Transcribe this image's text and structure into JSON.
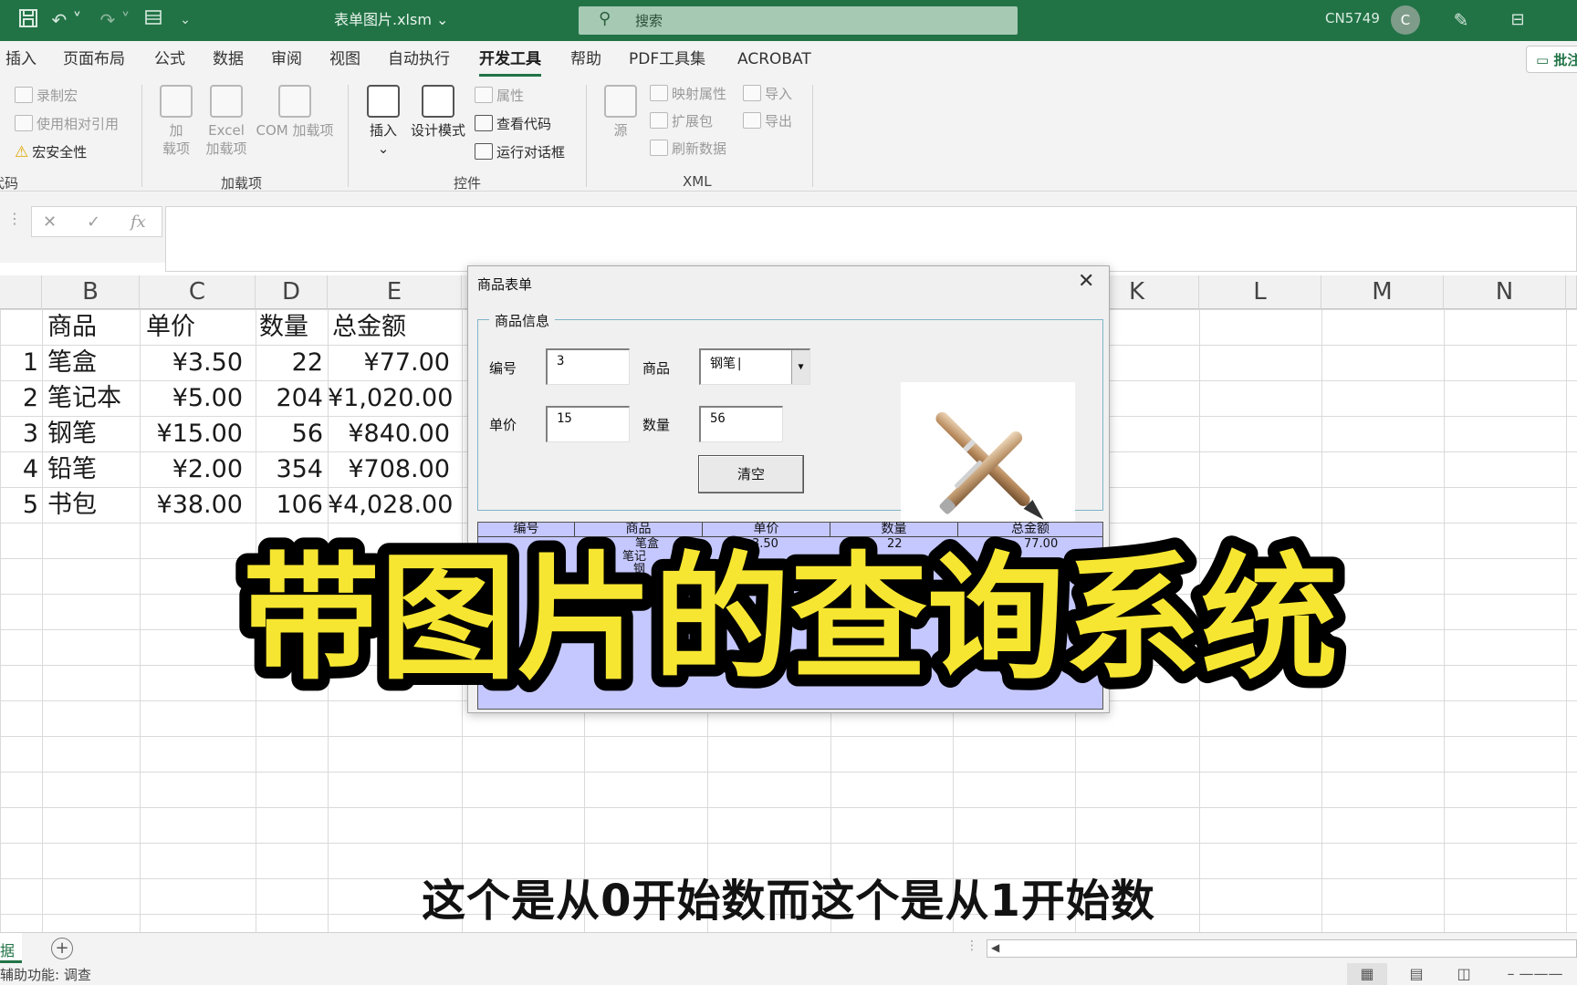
{
  "titlebar": {
    "filename": "表单图片.xlsm ⌄",
    "search_placeholder": "搜索",
    "user_id": "CN5749",
    "avatar_letter": "C"
  },
  "ribbon_tabs": [
    "插入",
    "页面布局",
    "公式",
    "数据",
    "审阅",
    "视图",
    "自动执行",
    "开发工具",
    "帮助",
    "PDF工具集",
    "ACROBAT"
  ],
  "active_tab": "开发工具",
  "comments_label": "批注",
  "ribbon": {
    "code": {
      "record_macro": "录制宏",
      "relative_ref": "使用相对引用",
      "macro_security": "宏安全性",
      "group": "代码"
    },
    "addins": {
      "addin": "加\n载项",
      "excel_addin": "Excel\n加载项",
      "com_addin": "COM 加载项",
      "group": "加载项"
    },
    "controls": {
      "insert": "插入",
      "design_mode": "设计模式",
      "properties": "属性",
      "view_code": "查看代码",
      "run_dialog": "运行对话框",
      "group": "控件"
    },
    "xml": {
      "source": "源",
      "map_props": "映射属性",
      "expansion": "扩展包",
      "refresh": "刷新数据",
      "import": "导入",
      "export": "导出",
      "group": "XML"
    }
  },
  "formula_bar": {
    "fx": "fx",
    "cancel": "✕",
    "enter": "✓",
    "content": ""
  },
  "columns": [
    "B",
    "C",
    "D",
    "E",
    "K",
    "L",
    "M",
    "N"
  ],
  "sheet": {
    "headers": [
      "商品",
      "单价",
      "数量",
      "总金额"
    ],
    "rows": [
      {
        "id": "1",
        "name": "笔盒",
        "price": "¥3.50",
        "qty": "22",
        "total": "¥77.00"
      },
      {
        "id": "2",
        "name": "笔记本",
        "price": "¥5.00",
        "qty": "204",
        "total": "¥1,020.00"
      },
      {
        "id": "3",
        "name": "钢笔",
        "price": "¥15.00",
        "qty": "56",
        "total": "¥840.00"
      },
      {
        "id": "4",
        "name": "铅笔",
        "price": "¥2.00",
        "qty": "354",
        "total": "¥708.00"
      },
      {
        "id": "5",
        "name": "书包",
        "price": "¥38.00",
        "qty": "106",
        "total": "¥4,028.00"
      }
    ]
  },
  "dialog": {
    "title": "商品表单",
    "close": "✕",
    "group_label": "商品信息",
    "id_label": "编号",
    "id_value": "3",
    "product_label": "商品",
    "product_value": "钢笔|",
    "price_label": "单价",
    "price_value": "15",
    "qty_label": "数量",
    "qty_value": "56",
    "clear_button": "清空",
    "list_headers": [
      "编号",
      "商品",
      "单价",
      "数量",
      "总金额"
    ],
    "list_first_row": {
      "name": "笔盒",
      "price": "3.50",
      "qty": "22",
      "total": "77.00"
    },
    "list_partial": [
      "笔记",
      "钢"
    ]
  },
  "overlay_title": "带图片的查询系统",
  "subtitle": "这个是从0开始数而这个是从1开始数",
  "sheet_tab_label": "据",
  "status_text": "辅助功能: 调查",
  "colors": {
    "excel_green": "#217346",
    "overlay_yellow": "#f7e631",
    "listbox_bg": "#c5c8ff"
  }
}
